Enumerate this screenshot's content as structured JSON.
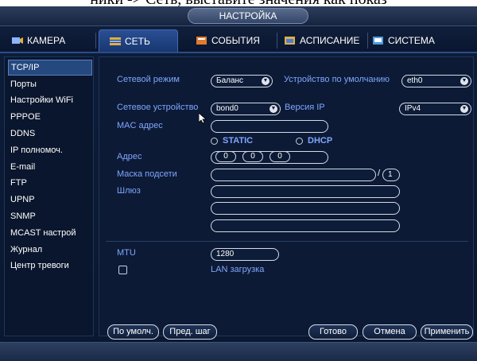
{
  "caption": "ники -> Сеть, выставите значения как показ",
  "window": {
    "title": "НАСТРОЙКА"
  },
  "tabs": [
    {
      "label": "КАМЕРА",
      "icon": "camera-icon"
    },
    {
      "label": "СЕТЬ",
      "icon": "network-icon"
    },
    {
      "label": "СОБЫТИЯ",
      "icon": "events-icon"
    },
    {
      "label": "АСПИСАНИЕ",
      "icon": "schedule-icon"
    },
    {
      "label": "СИСТЕМА",
      "icon": "system-icon"
    }
  ],
  "sidebar": {
    "items": [
      {
        "label": "TCP/IP"
      },
      {
        "label": "Порты"
      },
      {
        "label": "Настройки WiFi"
      },
      {
        "label": "PPPOE"
      },
      {
        "label": "DDNS"
      },
      {
        "label": "IP полномоч."
      },
      {
        "label": "E-mail"
      },
      {
        "label": "FTP"
      },
      {
        "label": "UPNP"
      },
      {
        "label": "SNMP"
      },
      {
        "label": "MCAST настрой"
      },
      {
        "label": "Журнал"
      },
      {
        "label": "Центр тревоги"
      }
    ]
  },
  "form": {
    "net_mode_label": "Сетевой режим",
    "net_mode_value": "Баланс",
    "default_device_label": "Устройство по умолчанию",
    "default_device_value": "eth0",
    "net_device_label": "Сетевое устройство",
    "net_device_value": "bond0",
    "ip_version_label": "Версия IP",
    "ip_version_value": "IPv4",
    "mac_label": "MAC адрес",
    "mac_value": "",
    "static_label": "STATIC",
    "dhcp_label": "DHCP",
    "address_label": "Адрес",
    "address_octets": [
      "0",
      "0",
      "0"
    ],
    "subnet_label": "Маска подсети",
    "subnet_prefix": "1",
    "gateway_label": "Шлюз",
    "mtu_label": "MTU",
    "mtu_value": "1280",
    "lan_upload_label": "LAN загрузка"
  },
  "buttons": {
    "default": "По умолч.",
    "prev": "Пред. шаг",
    "ok": "Готово",
    "cancel": "Отмена",
    "apply": "Применить"
  },
  "colors": {
    "label_blue": "#7fa6ff",
    "active_tab": "#2a4f95",
    "background": "#0c1a35"
  }
}
